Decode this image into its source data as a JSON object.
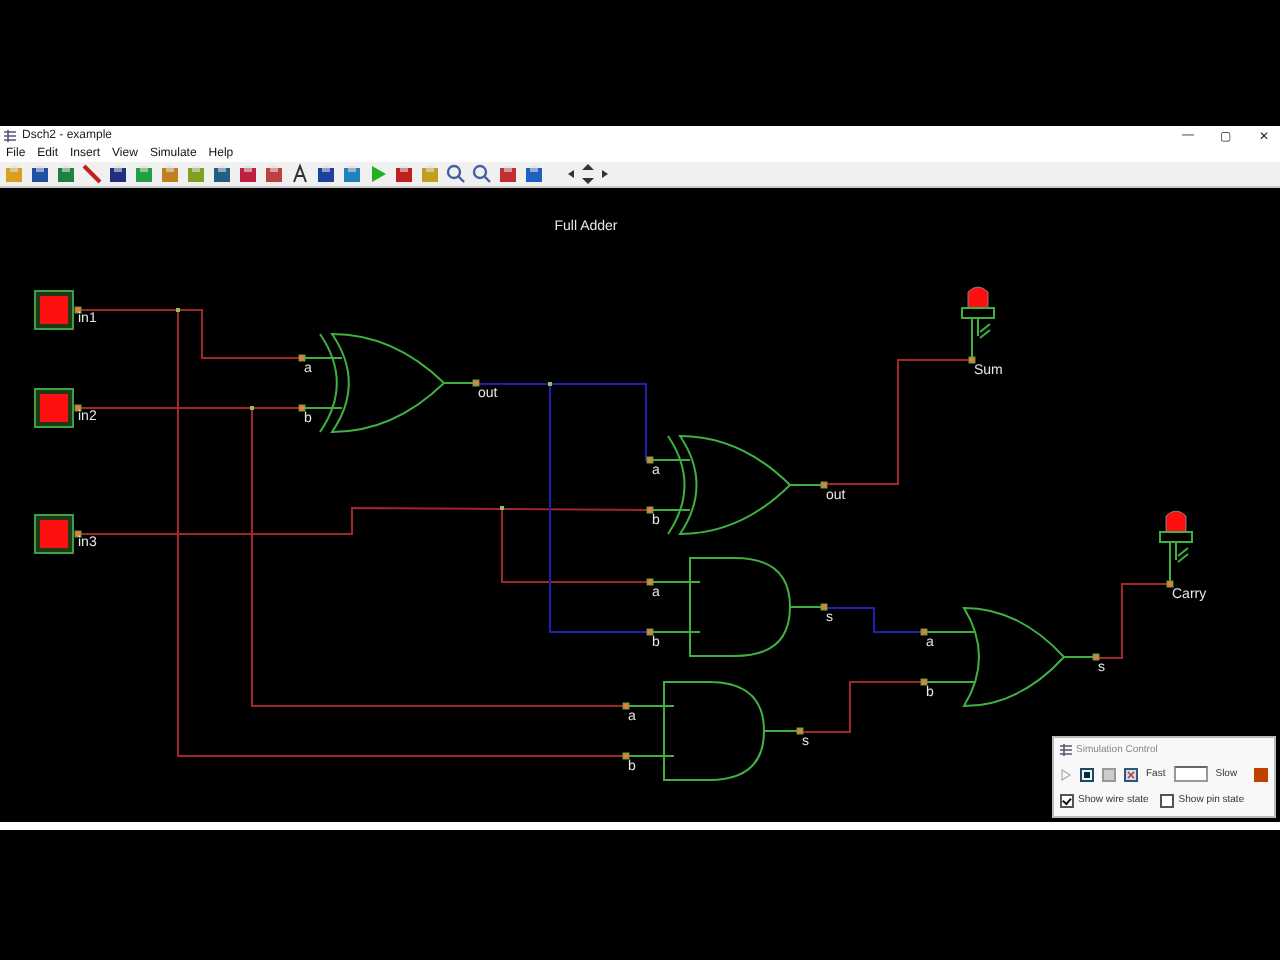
{
  "window": {
    "title": "Dsch2 - example",
    "controls": [
      "—",
      "▢",
      "✕"
    ]
  },
  "menu": [
    "File",
    "Edit",
    "Insert",
    "View",
    "Simulate",
    "Help"
  ],
  "canvas": {
    "title": "Full Adder",
    "inputs": [
      {
        "label": "in1",
        "on": true
      },
      {
        "label": "in2",
        "on": true
      },
      {
        "label": "in3",
        "on": true
      }
    ],
    "gates": [
      {
        "kind": "xor",
        "inputs": [
          "a",
          "b"
        ],
        "output": "out"
      },
      {
        "kind": "xor",
        "inputs": [
          "a",
          "b"
        ],
        "output": "out"
      },
      {
        "kind": "and",
        "inputs": [
          "a",
          "b"
        ],
        "output": "s"
      },
      {
        "kind": "and",
        "inputs": [
          "a",
          "b"
        ],
        "output": "s"
      },
      {
        "kind": "or",
        "inputs": [
          "a",
          "b"
        ],
        "output": "s"
      }
    ],
    "leds": [
      {
        "label": "Sum",
        "on": true
      },
      {
        "label": "Carry",
        "on": true
      }
    ],
    "wires": [
      {
        "color": "#a02828"
      },
      {
        "color": "#a02828"
      },
      {
        "color": "#a02828"
      },
      {
        "color": "#a02828"
      },
      {
        "color": "#a02828"
      },
      {
        "color": "#a02828"
      },
      {
        "color": "#2020b0"
      },
      {
        "color": "#2020b0"
      },
      {
        "color": "#a02828"
      },
      {
        "color": "#2020b0"
      },
      {
        "color": "#a02828"
      },
      {
        "color": "#a02828"
      }
    ]
  },
  "simulation_control": {
    "title": "Simulation Control",
    "fast": "Fast",
    "slow": "Slow",
    "options": [
      {
        "label": "Show wire state",
        "checked": true
      },
      {
        "label": "Show pin state",
        "checked": false
      }
    ]
  }
}
